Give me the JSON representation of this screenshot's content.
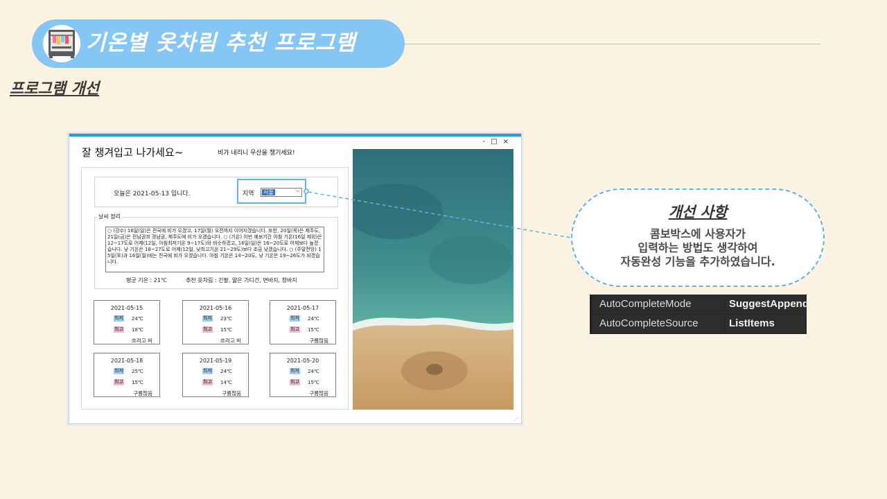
{
  "slide": {
    "title": "기온별 옷차림 추천 프로그램",
    "section_title": "프로그램 개선",
    "title_icon": "wardrobe-icon"
  },
  "app": {
    "heading": "잘 챙겨입고 나가세요~",
    "rain_message": "비가 내리니 우산을 챙기세요!",
    "window_controls": [
      "-",
      "□",
      "×"
    ],
    "today_text": "오늘은 2021-05-13 입니다.",
    "region_label": "지역",
    "region_value": "서울",
    "weather_group_label": "날씨 정리",
    "weather_text": "○ (강수) 16일(일)은 전국에 비가 오겠고, 17일(월) 오전까지 이어지겠습니다. 또한, 20일(목)은 제주도, 21일(금)은 전남권과 경남권, 제주도에 비가 오겠습니다. ○ (기온) 이번 예보기간 아침 기온(16일 제외)은 12~17도로 어제(12일, 아침최저기온 9~17도)와 비슷하겠고, 16일(일)은 16~20도로 어제보다 높겠습니다. 낮 기온은 18~27도로 어제(12일, 낮최고기온 21~29도)보다 조금 낮겠습니다. ○ (주말전망) 15일(토)과 16일(일)에는 전국에 비가 오겠습니다. 아침 기온은 14~20도, 낮 기온은 19~26도가 되겠습니다.",
    "avg_temp": "평균 기온 : 21℃",
    "recommendation": "추천 옷차림 : 긴팔, 얇은 가디건, 면바지, 청바지",
    "low_label": "최저",
    "high_label": "최고",
    "forecasts": [
      {
        "date": "2021-05-15",
        "low": "24℃",
        "high": "18℃",
        "desc": "흐리고 비"
      },
      {
        "date": "2021-05-16",
        "low": "23℃",
        "high": "15℃",
        "desc": "흐리고 비"
      },
      {
        "date": "2021-05-17",
        "low": "24℃",
        "high": "15℃",
        "desc": "구름많음"
      },
      {
        "date": "2021-05-18",
        "low": "25℃",
        "high": "15℃",
        "desc": "구름많음"
      },
      {
        "date": "2021-05-19",
        "low": "24℃",
        "high": "14℃",
        "desc": "구름많음"
      },
      {
        "date": "2021-05-20",
        "low": "24℃",
        "high": "15℃",
        "desc": "구름많음"
      }
    ]
  },
  "callout": {
    "title": "개선 사항",
    "lines": [
      "콤보박스에 사용자가",
      "입력하는 방법도 생각하여",
      "자동완성 기능을 추가하였습니다."
    ]
  },
  "properties": [
    {
      "name": "AutoCompleteMode",
      "value": "SuggestAppend"
    },
    {
      "name": "AutoCompleteSource",
      "value": "ListItems"
    }
  ],
  "colors": {
    "background": "#fdf3e2",
    "title_pill": "#86c6f4",
    "accent": "#5bb6ee",
    "window_bar": "#1a9fd6"
  }
}
